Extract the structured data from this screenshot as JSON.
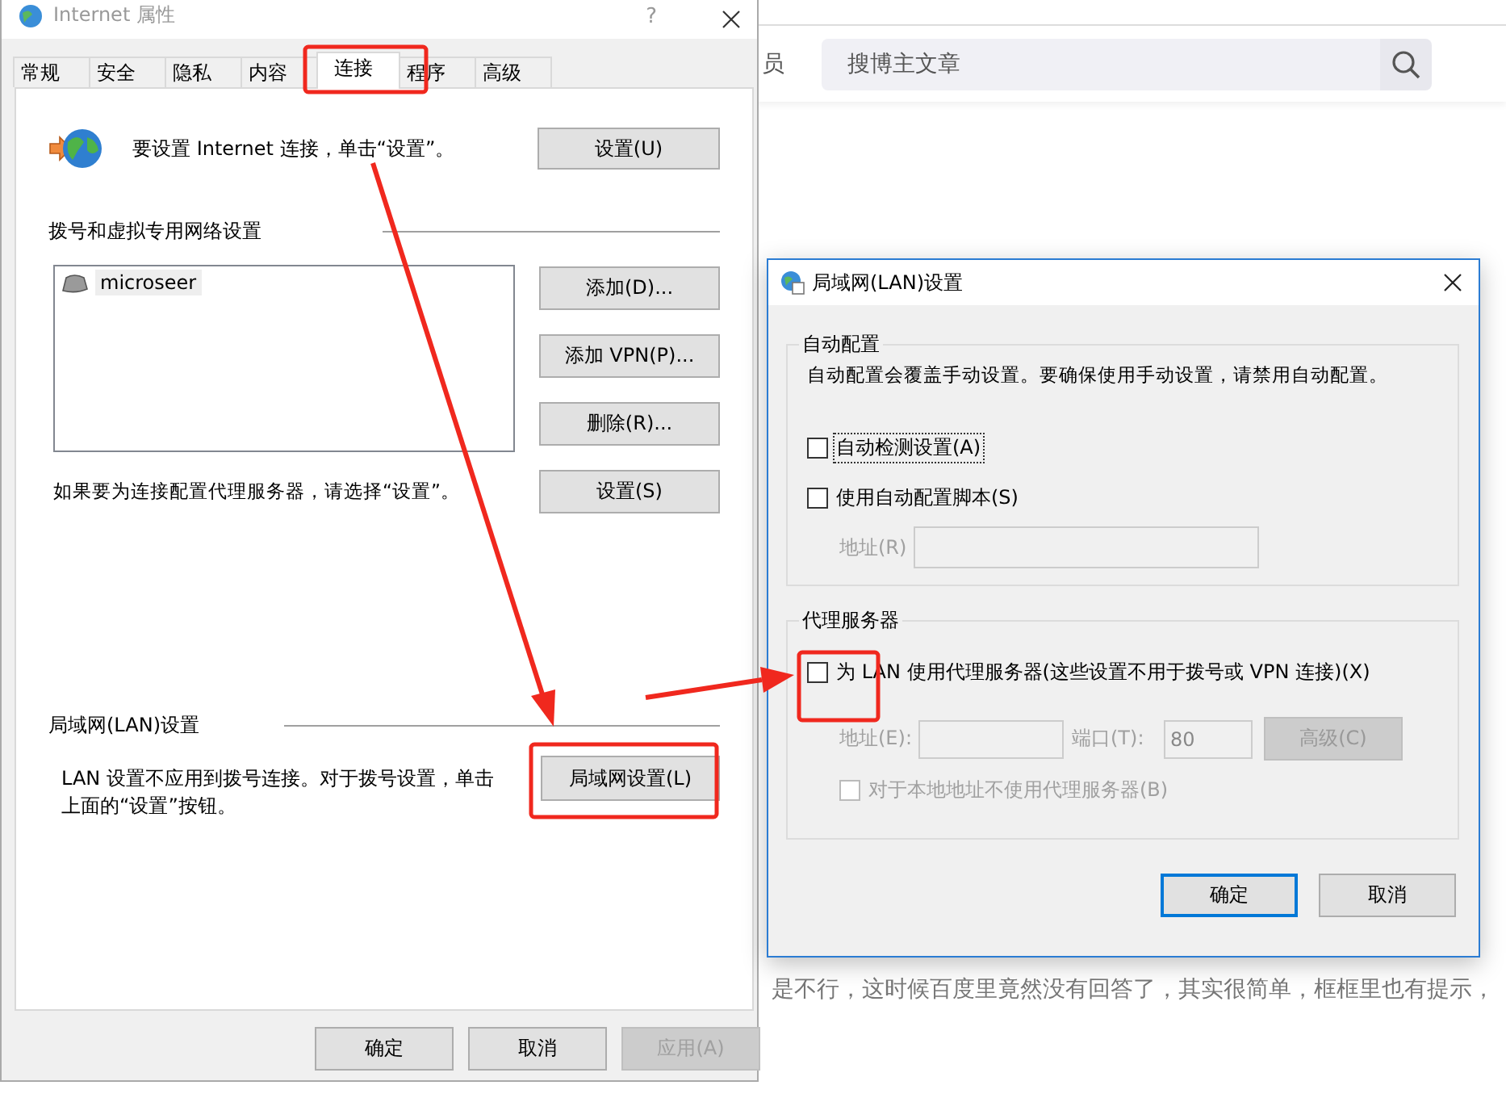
{
  "browser_page": {
    "nav_fragment": "员",
    "search": {
      "placeholder": "搜博主文章"
    },
    "article_text": "是不行，这时候百度里竟然没有回答了，其实很简单，框框里也有提示，"
  },
  "internet_properties": {
    "title": "Internet 属性",
    "help": "?",
    "tabs": [
      {
        "label": "常规",
        "selected": false
      },
      {
        "label": "安全",
        "selected": false
      },
      {
        "label": "隐私",
        "selected": false
      },
      {
        "label": "内容",
        "selected": false
      },
      {
        "label": "连接",
        "selected": true
      },
      {
        "label": "程序",
        "selected": false
      },
      {
        "label": "高级",
        "selected": false
      }
    ],
    "intro_text": "要设置 Internet 连接，单击“设置”。",
    "setup_button": "设置(U)",
    "dialup_heading": "拨号和虚拟专用网络设置",
    "connections": [
      "microseer"
    ],
    "dialup_buttons": [
      "添加(D)...",
      "添加 VPN(P)...",
      "删除(R)..."
    ],
    "proxy_hint": "如果要为连接配置代理服务器，请选择“设置”。",
    "proxy_settings_button": "设置(S)",
    "lan_heading": "局域网(LAN)设置",
    "lan_text": "LAN 设置不应用到拨号连接。对于拨号设置，单击上面的“设置”按钮。",
    "lan_button": "局域网设置(L)",
    "footer_buttons": [
      {
        "label": "确定",
        "disabled": false
      },
      {
        "label": "取消",
        "disabled": false
      },
      {
        "label": "应用(A)",
        "disabled": true
      }
    ]
  },
  "lan_dialog": {
    "title": "局域网(LAN)设置",
    "auto_group": {
      "heading": "自动配置",
      "description": "自动配置会覆盖手动设置。要确保使用手动设置，请禁用自动配置。",
      "options": [
        {
          "label": "自动检测设置(A)",
          "checked": false,
          "focused": true
        },
        {
          "label": "使用自动配置脚本(S)",
          "checked": false,
          "focused": false
        }
      ],
      "address": {
        "label": "地址(R)",
        "disabled": true
      }
    },
    "proxy_group": {
      "heading": "代理服务器",
      "use_proxy": {
        "label": "为 LAN 使用代理服务器(这些设置不用于拨号或 VPN 连接)(X)",
        "checked": false
      },
      "address": {
        "label": "地址(E):",
        "disabled": true
      },
      "port": {
        "label": "端口(T):",
        "value": "80",
        "disabled": true
      },
      "advanced_button": {
        "label": "高级(C)",
        "disabled": true
      },
      "bypass_local": {
        "label": "对于本地地址不使用代理服务器(B)",
        "checked": false,
        "disabled": true
      }
    },
    "buttons": [
      {
        "label": "确定",
        "default": true
      },
      {
        "label": "取消",
        "default": false
      }
    ]
  }
}
